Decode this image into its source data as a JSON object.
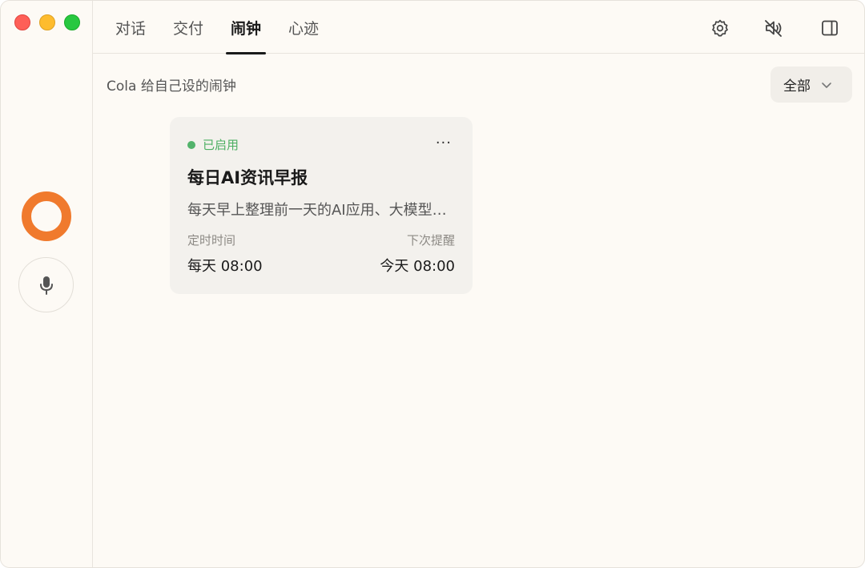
{
  "window": {
    "traffic_lights": [
      "close",
      "minimize",
      "maximize"
    ]
  },
  "rail": {
    "avatar": {
      "color": "#f07a2d"
    },
    "mic_icon": "microphone-icon"
  },
  "header": {
    "tabs": [
      {
        "label": "对话",
        "active": false
      },
      {
        "label": "交付",
        "active": false
      },
      {
        "label": "闹钟",
        "active": true
      },
      {
        "label": "心迹",
        "active": false
      }
    ],
    "actions": [
      "gear-icon",
      "speaker-muted-icon",
      "sidebar-toggle-icon"
    ]
  },
  "main": {
    "subtitle": "Cola 给自己设的闹钟",
    "filter": {
      "label": "全部",
      "icon": "chevron-down-icon"
    },
    "alarms": [
      {
        "status": "已启用",
        "status_color": "#52b36b",
        "title": "每日AI资讯早报",
        "description": "每天早上整理前一天的AI应用、大模型相关资讯",
        "schedule_label": "定时时间",
        "schedule_value": "每天 08:00",
        "next_label": "下次提醒",
        "next_value": "今天 08:00",
        "more_label": "···"
      }
    ]
  }
}
